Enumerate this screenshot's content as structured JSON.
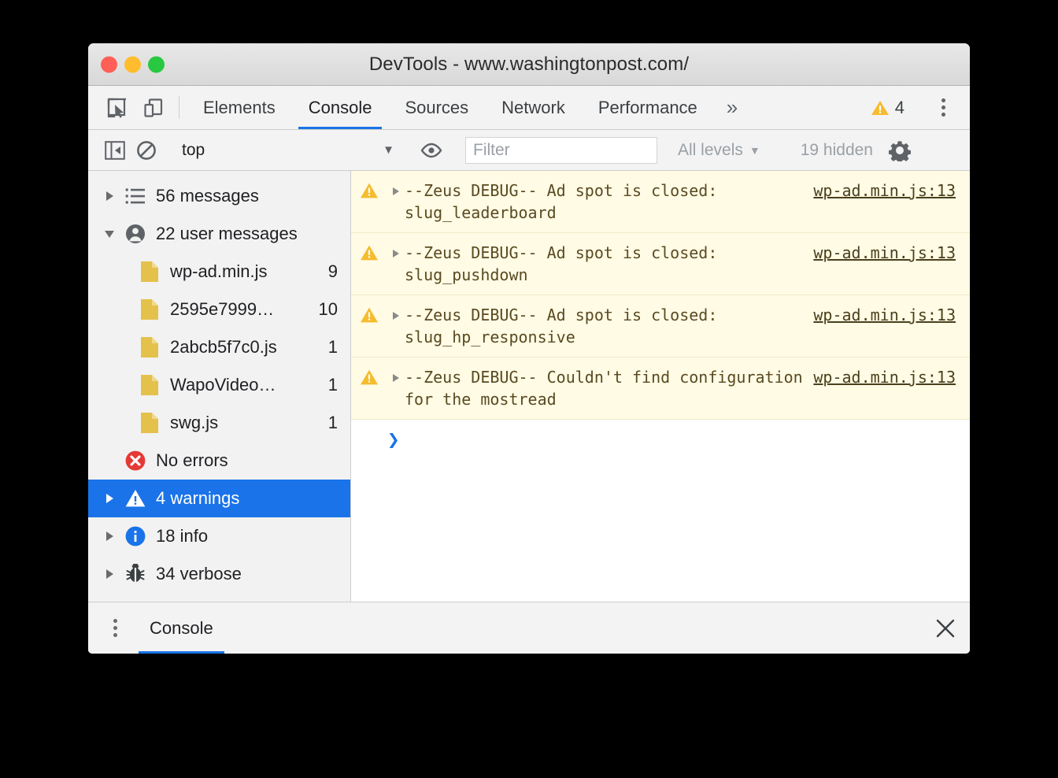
{
  "window": {
    "title": "DevTools - www.washingtonpost.com/",
    "traffic_lights": [
      "close",
      "minimize",
      "zoom"
    ]
  },
  "tabstrip": {
    "inspect_icon": "inspect-element-icon",
    "device_icon": "device-toolbar-icon",
    "tabs": [
      {
        "label": "Elements",
        "active": false
      },
      {
        "label": "Console",
        "active": true
      },
      {
        "label": "Sources",
        "active": false
      },
      {
        "label": "Network",
        "active": false
      },
      {
        "label": "Performance",
        "active": false
      }
    ],
    "more_label": "»",
    "warning_count": "4",
    "warning_icon": "warning-triangle-icon",
    "menu_icon": "kebab-menu-icon"
  },
  "toolbar": {
    "sidebar_toggle_icon": "console-sidebar-toggle-icon",
    "clear_icon": "clear-console-icon",
    "context": "top",
    "context_caret": "▼",
    "eye_icon": "live-expression-eye-icon",
    "filter_placeholder": "Filter",
    "filter_value": "",
    "levels_label": "All levels",
    "levels_caret": "▼",
    "hidden_label": "19 hidden",
    "settings_icon": "settings-gear-icon"
  },
  "sidebar": {
    "items": [
      {
        "label": "56 messages",
        "icon": "list-icon",
        "count": "",
        "expanded": false,
        "selected": false,
        "child": false,
        "has_twisty": true
      },
      {
        "label": "22 user messages",
        "icon": "user-icon",
        "count": "",
        "expanded": true,
        "selected": false,
        "child": false,
        "has_twisty": true
      },
      {
        "label": "wp-ad.min.js",
        "icon": "js-file-icon",
        "count": "9",
        "selected": false,
        "child": true,
        "has_twisty": false
      },
      {
        "label": "2595e7999…",
        "icon": "js-file-icon",
        "count": "10",
        "selected": false,
        "child": true,
        "has_twisty": false
      },
      {
        "label": "2abcb5f7c0.js",
        "icon": "js-file-icon",
        "count": "1",
        "selected": false,
        "child": true,
        "has_twisty": false
      },
      {
        "label": "WapoVideo…",
        "icon": "js-file-icon",
        "count": "1",
        "selected": false,
        "child": true,
        "has_twisty": false
      },
      {
        "label": "swg.js",
        "icon": "js-file-icon",
        "count": "1",
        "selected": false,
        "child": true,
        "has_twisty": false
      },
      {
        "label": "No errors",
        "icon": "error-circle-icon",
        "count": "",
        "selected": false,
        "child": false,
        "has_twisty": false
      },
      {
        "label": "4 warnings",
        "icon": "warning-triangle-icon",
        "count": "",
        "selected": true,
        "child": false,
        "has_twisty": true
      },
      {
        "label": "18 info",
        "icon": "info-circle-icon",
        "count": "",
        "selected": false,
        "child": false,
        "has_twisty": true
      },
      {
        "label": "34 verbose",
        "icon": "bug-icon",
        "count": "",
        "selected": false,
        "child": false,
        "has_twisty": true
      }
    ]
  },
  "console": {
    "messages": [
      {
        "level": "warning",
        "text": "--Zeus DEBUG-- Ad spot is closed: slug_leaderboard",
        "source": "wp-ad.min.js:13"
      },
      {
        "level": "warning",
        "text": "--Zeus DEBUG-- Ad spot is closed: slug_pushdown",
        "source": "wp-ad.min.js:13"
      },
      {
        "level": "warning",
        "text": "--Zeus DEBUG-- Ad spot is closed: slug_hp_responsive",
        "source": "wp-ad.min.js:13"
      },
      {
        "level": "warning",
        "text": "--Zeus DEBUG-- Couldn't find configuration for the mostread",
        "source": "wp-ad.min.js:13"
      }
    ],
    "prompt_symbol": "❯",
    "prompt_value": ""
  },
  "drawer": {
    "menu_icon": "drawer-kebab-icon",
    "tab_label": "Console",
    "close_icon": "close-icon"
  },
  "colors": {
    "accent_blue": "#1a73e8",
    "warning_yellow": "#fffbe5",
    "warning_icon": "#f5bc2e",
    "error_red": "#e53935",
    "info_blue": "#1a73e8",
    "file_icon": "#e4c14b"
  }
}
